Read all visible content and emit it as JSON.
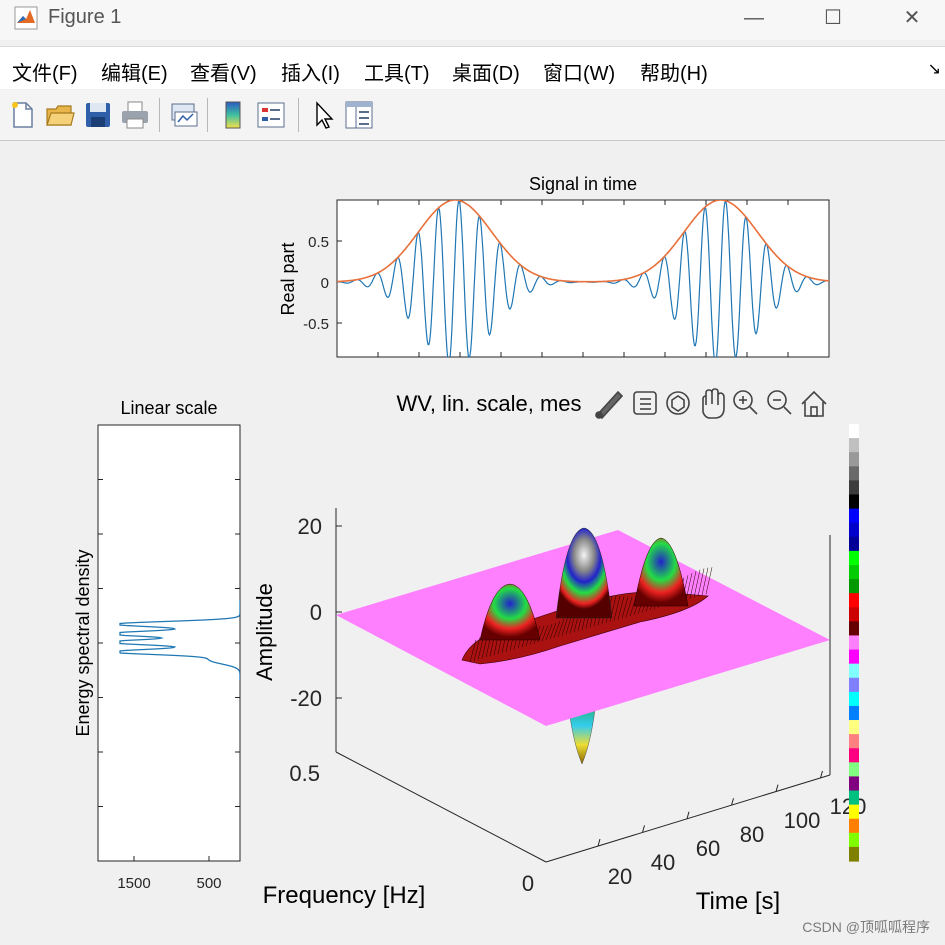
{
  "window": {
    "title": "Figure 1",
    "min_glyph": "—",
    "max_glyph": "☐",
    "close_glyph": "✕"
  },
  "menu": [
    {
      "label": "文件(F)"
    },
    {
      "label": "编辑(E)"
    },
    {
      "label": "查看(V)"
    },
    {
      "label": "插入(I)"
    },
    {
      "label": "工具(T)"
    },
    {
      "label": "桌面(D)"
    },
    {
      "label": "窗口(W)"
    },
    {
      "label": "帮助(H)"
    }
  ],
  "menu_overflow_glyph": "↘",
  "toolbar": [
    {
      "icon": "new-figure-icon"
    },
    {
      "icon": "open-file-icon"
    },
    {
      "icon": "save-icon"
    },
    {
      "icon": "print-icon"
    },
    {
      "icon": "link-plot-icon"
    },
    {
      "icon": "colorbar-icon"
    },
    {
      "icon": "legend-icon"
    },
    {
      "icon": "pointer-icon"
    },
    {
      "icon": "property-inspector-icon"
    }
  ],
  "axes_toolbar": [
    {
      "icon": "brush-icon"
    },
    {
      "icon": "data-tips-icon"
    },
    {
      "icon": "rotate-3d-icon"
    },
    {
      "icon": "pan-icon"
    },
    {
      "icon": "zoom-in-icon"
    },
    {
      "icon": "zoom-out-icon"
    },
    {
      "icon": "home-icon"
    }
  ],
  "colors": {
    "signal": "#1f77b4",
    "envelope": "#e8703a",
    "plane": "#ff80ff"
  },
  "chart_data": [
    {
      "type": "line",
      "title": "Signal in time",
      "ylabel": "Real part",
      "xlabel": "",
      "ylim": [
        -0.95,
        0.95
      ],
      "yticks": [
        "0.5",
        "0",
        "-0.5"
      ],
      "series": [
        {
          "description": "signal",
          "x_normalized_time": "0..1",
          "values": "two gaussian-modulated oscillation bursts peaking near 0.24 and 0.78"
        },
        {
          "description": "envelope",
          "peaks": [
            0.24,
            0.78
          ],
          "peak_value": 0.95
        }
      ]
    },
    {
      "type": "line",
      "title": "Linear scale",
      "ylabel": "Energy spectral density",
      "xticks": [
        "1500",
        "500"
      ]
    },
    {
      "type": "area",
      "title": "WV, lin. scale, mes",
      "zlabel": "Amplitude",
      "ylabel": "Frequency [Hz]",
      "xlabel": "Time [s]",
      "zticks": [
        "20",
        "0",
        "-20"
      ],
      "yticks": [
        "0.5",
        "0"
      ],
      "xticks": [
        "20",
        "40",
        "60",
        "80",
        "100",
        "120"
      ],
      "zlim": [
        -25,
        25
      ]
    }
  ],
  "watermark": "CSDN @顶呱呱程序"
}
